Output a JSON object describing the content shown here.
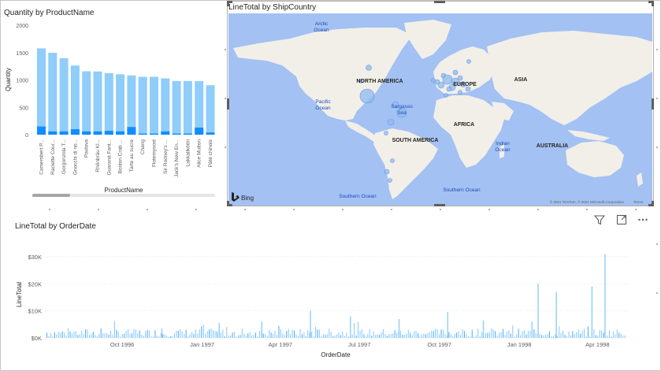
{
  "bar_visual": {
    "title": "Quantity by ProductName",
    "xlabel": "ProductName",
    "ylabel": "Quantity"
  },
  "map_visual": {
    "title": "LineTotal by ShipCountry",
    "labels": {
      "arctic": "Arctic Ocean",
      "north_america": "NORTH AMERICA",
      "europe": "EUROPE",
      "asia": "ASIA",
      "pacific": "Pacific Ocean",
      "sargasso": "Sargasso Sea",
      "africa": "AFRICA",
      "south_america": "SOUTH AMERICA",
      "indian": "Indian Ocean",
      "australia": "AUSTRALIA",
      "southern_left": "Southern Ocean",
      "southern_right": "Southern Ocean"
    },
    "bing_label": "Bing",
    "copyright": "© 2021 TomTom, © 2021 Microsoft Corporation",
    "terms": "Terms",
    "colors": {
      "water": "#a3c1f2",
      "land": "#f2efe9",
      "bubble": "#8fbaf0"
    }
  },
  "line_visual": {
    "title": "LineTotal by OrderDate",
    "xlabel": "OrderDate",
    "ylabel": "LineTotal",
    "header_icons": [
      "filter-icon",
      "focus-mode-icon",
      "more-options-icon"
    ]
  },
  "chart_data": [
    {
      "type": "bar",
      "title": "Quantity by ProductName",
      "xlabel": "ProductName",
      "ylabel": "Quantity",
      "ylim": [
        0,
        2000
      ],
      "yticks": [
        "2000",
        "1500",
        "1000",
        "500",
        "0"
      ],
      "categories": [
        "Camembert P...",
        "Raclette Cour...",
        "Gorgonzola T...",
        "Gnocchi di no...",
        "Pavlova",
        "Rhönbräu Kl...",
        "Guaraná Fant...",
        "Boston Crab ...",
        "Tarte au sucre",
        "Chang",
        "Flotemysost",
        "Sir Rodney's ...",
        "Jack's New En...",
        "Lakkalikööri",
        "Alice Mutton",
        "Pâté chinois"
      ],
      "values": [
        1577,
        1496,
        1397,
        1263,
        1158,
        1155,
        1125,
        1103,
        1083,
        1057,
        1057,
        1029,
        981,
        981,
        978,
        903
      ],
      "highlight_values": [
        150,
        60,
        60,
        100,
        60,
        60,
        70,
        60,
        140,
        20,
        20,
        60,
        20,
        20,
        130,
        40
      ],
      "colors": {
        "bar": "#8fcdfa",
        "highlight": "#118dff"
      },
      "grid": false
    },
    {
      "type": "bar",
      "title": "LineTotal by OrderDate",
      "xlabel": "OrderDate",
      "ylabel": "LineTotal",
      "ylim": [
        0,
        32000
      ],
      "yticks": [
        "$30K",
        "$20K",
        "$10K",
        "$0K"
      ],
      "ytick_values": [
        30000,
        20000,
        10000,
        0
      ],
      "x_range": [
        "1996-07-04",
        "1998-05-06"
      ],
      "xticks": [
        {
          "label": "Oct 1996",
          "date": "1996-10-01"
        },
        {
          "label": "Jan 1997",
          "date": "1997-01-01"
        },
        {
          "label": "Apr 1997",
          "date": "1997-04-01"
        },
        {
          "label": "Jul 1997",
          "date": "1997-07-01"
        },
        {
          "label": "Oct 1997",
          "date": "1997-10-01"
        },
        {
          "label": "Jan 1998",
          "date": "1998-01-01"
        },
        {
          "label": "Apr 1998",
          "date": "1998-04-01"
        }
      ],
      "peaks": [
        {
          "date": "1996-11-15",
          "value": 3500
        },
        {
          "date": "1997-01-20",
          "value": 5500
        },
        {
          "date": "1997-03-10",
          "value": 6000
        },
        {
          "date": "1997-05-05",
          "value": 10000
        },
        {
          "date": "1997-06-20",
          "value": 8000
        },
        {
          "date": "1997-08-15",
          "value": 7000
        },
        {
          "date": "1997-10-10",
          "value": 9500
        },
        {
          "date": "1997-11-20",
          "value": 6500
        },
        {
          "date": "1998-01-15",
          "value": 6000
        },
        {
          "date": "1998-01-22",
          "value": 20000
        },
        {
          "date": "1998-02-12",
          "value": 17000
        },
        {
          "date": "1998-03-25",
          "value": 19000
        },
        {
          "date": "1998-04-09",
          "value": 31000
        }
      ],
      "colors": {
        "bar": "#8fcdfa",
        "highlight": "#118dff"
      },
      "grid": true
    }
  ]
}
